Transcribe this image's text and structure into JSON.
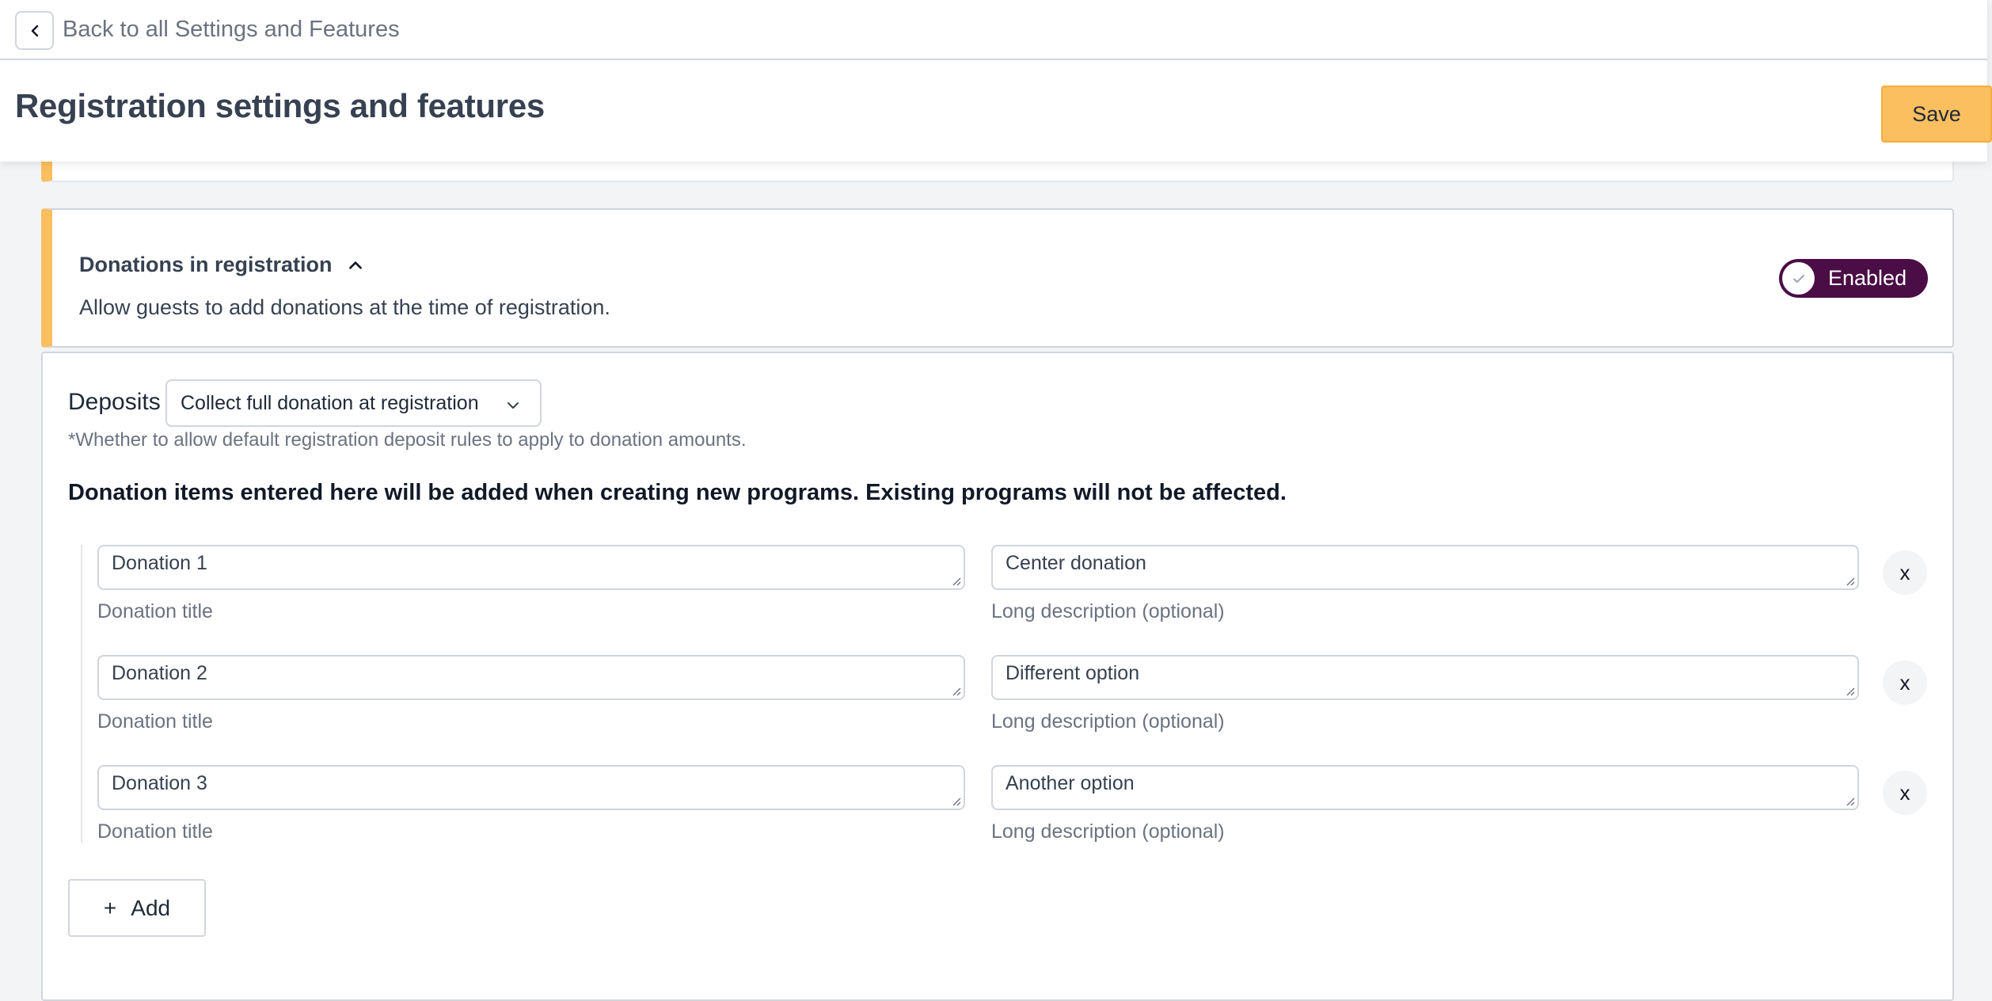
{
  "header": {
    "back_label": "Back to all Settings and Features",
    "title": "Registration settings and features",
    "save_label": "Save"
  },
  "feature": {
    "title": "Donations in registration",
    "description": "Allow guests to add donations at the time of registration.",
    "toggle_label": "Enabled",
    "toggle_on": true
  },
  "deposits": {
    "label": "Deposits",
    "selected": "Collect full donation at registration",
    "note": "*Whether to allow default registration deposit rules to apply to donation amounts."
  },
  "donations": {
    "heading": "Donation items entered here will be added when creating new programs. Existing programs will not be affected.",
    "title_caption": "Donation title",
    "desc_caption": "Long description (optional)",
    "remove_label": "x",
    "items": [
      {
        "title": "Donation 1",
        "description": "Center donation"
      },
      {
        "title": "Donation 2",
        "description": "Different option"
      },
      {
        "title": "Donation 3",
        "description": "Another option"
      }
    ],
    "add_label": "Add",
    "add_icon": "+"
  },
  "colors": {
    "accent": "#fbbf5f",
    "toggle": "#4a0d45"
  }
}
